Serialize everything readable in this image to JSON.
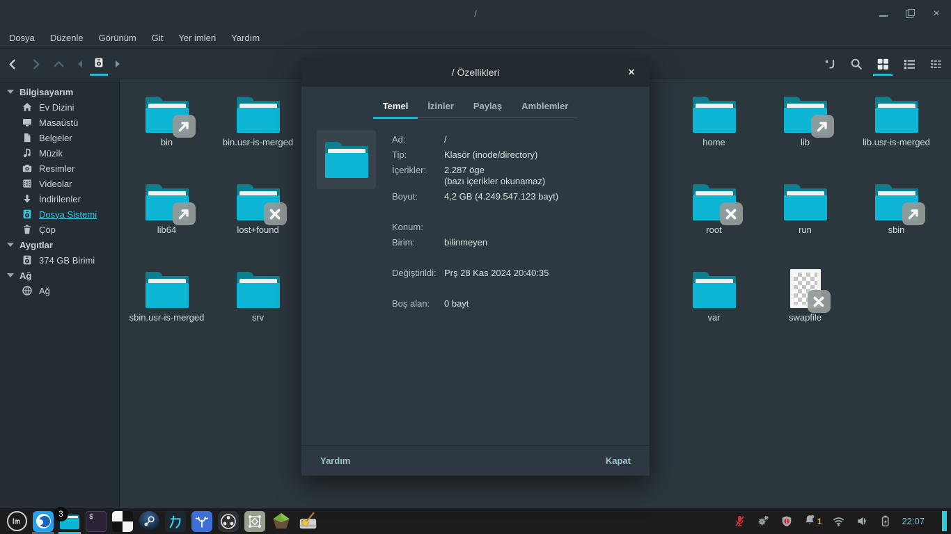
{
  "window": {
    "title": "/"
  },
  "menubar": {
    "items": [
      "Dosya",
      "Düzenle",
      "Görünüm",
      "Git",
      "Yer imleri",
      "Yardım"
    ]
  },
  "sidebar": {
    "sections": [
      {
        "label": "Bilgisayarım",
        "items": [
          {
            "label": "Ev Dizini",
            "icon": "home-icon"
          },
          {
            "label": "Masaüstü",
            "icon": "desktop-icon"
          },
          {
            "label": "Belgeler",
            "icon": "document-icon"
          },
          {
            "label": "Müzik",
            "icon": "music-icon"
          },
          {
            "label": "Resimler",
            "icon": "camera-icon"
          },
          {
            "label": "Videolar",
            "icon": "film-icon"
          },
          {
            "label": "İndirilenler",
            "icon": "download-icon"
          },
          {
            "label": "Dosya Sistemi",
            "icon": "drive-icon",
            "active": true
          },
          {
            "label": "Çöp",
            "icon": "trash-icon"
          }
        ]
      },
      {
        "label": "Aygıtlar",
        "items": [
          {
            "label": "374 GB Birimi",
            "icon": "drive-icon"
          }
        ]
      },
      {
        "label": "Ağ",
        "items": [
          {
            "label": "Ağ",
            "icon": "network-icon"
          }
        ]
      }
    ]
  },
  "files": [
    {
      "name": "bin",
      "kind": "folder",
      "emblem": "symlink",
      "col": 0,
      "row": 0
    },
    {
      "name": "bin.usr-is-merged",
      "kind": "folder",
      "emblem": null,
      "col": 1,
      "row": 0
    },
    {
      "name": "lib64",
      "kind": "folder",
      "emblem": "symlink",
      "col": 0,
      "row": 1
    },
    {
      "name": "lost+found",
      "kind": "folder",
      "emblem": "noread",
      "col": 1,
      "row": 1
    },
    {
      "name": "sbin.usr-is-merged",
      "kind": "folder",
      "emblem": null,
      "col": 0,
      "row": 2
    },
    {
      "name": "srv",
      "kind": "folder",
      "emblem": null,
      "col": 1,
      "row": 2
    },
    {
      "name": "home",
      "kind": "folder",
      "emblem": null,
      "col": 6,
      "row": 0
    },
    {
      "name": "lib",
      "kind": "folder",
      "emblem": "symlink",
      "col": 7,
      "row": 0
    },
    {
      "name": "lib.usr-is-merged",
      "kind": "folder",
      "emblem": null,
      "col": 8,
      "row": 0
    },
    {
      "name": "root",
      "kind": "folder",
      "emblem": "noread",
      "col": 6,
      "row": 1
    },
    {
      "name": "run",
      "kind": "folder",
      "emblem": null,
      "col": 7,
      "row": 1
    },
    {
      "name": "sbin",
      "kind": "folder",
      "emblem": "symlink",
      "col": 8,
      "row": 1
    },
    {
      "name": "var",
      "kind": "folder",
      "emblem": null,
      "col": 6,
      "row": 2
    },
    {
      "name": "swapfile",
      "kind": "checkerfile",
      "emblem": "noread",
      "col": 7,
      "row": 2
    }
  ],
  "dialog": {
    "title": "/ Özellikleri",
    "tabs": [
      "Temel",
      "İzinler",
      "Paylaş",
      "Amblemler"
    ],
    "active_tab": "Temel",
    "fields": [
      {
        "label": "Ad:",
        "value": "/"
      },
      {
        "label": "Tip:",
        "value": "Klasör (inode/directory)"
      },
      {
        "label": "İçerikler:",
        "value": "2.287 öge",
        "value2": "(bazı içerikler okunamaz)"
      },
      {
        "label": "Boyut:",
        "value": "4,2 GB (4.249.547.123 bayt)"
      },
      {
        "label": "Konum:",
        "value": ""
      },
      {
        "label": "Birim:",
        "value": "bilinmeyen"
      },
      {
        "label": "Değiştirildi:",
        "value": "Prş 28 Kas 2024 20:40:35"
      },
      {
        "label": "Boş alan:",
        "value": "0 bayt"
      }
    ],
    "help_label": "Yardım",
    "close_label": "Kapat"
  },
  "taskbar": {
    "apps": [
      {
        "icon": "mint-menu-icon"
      },
      {
        "icon": "firefox-icon",
        "indicator": "#5c6468"
      },
      {
        "icon": "file-manager-icon",
        "indicator": "#2cc0d8",
        "badge": "3"
      },
      {
        "icon": "terminal-icon"
      },
      {
        "icon": "checkerboard-app-icon"
      },
      {
        "icon": "steam-icon"
      },
      {
        "icon": "kanji-app-icon"
      },
      {
        "icon": "coral-app-icon"
      },
      {
        "icon": "obs-icon"
      },
      {
        "icon": "frame-app-icon"
      },
      {
        "icon": "green-block-game-icon"
      },
      {
        "icon": "disk-cleaner-icon"
      }
    ],
    "tray": {
      "notification_count": "1",
      "clock": "22:07"
    }
  },
  "colors": {
    "accent": "#2bb6d4",
    "folder_front": "#0db6d4",
    "folder_back": "#0c7f90",
    "content_bg": "#2c363d",
    "sidebar_bg": "#242d33",
    "bar_bg": "#273137",
    "dialog_bg": "#2e3840",
    "taskbar_bg": "#1c1c1c"
  }
}
